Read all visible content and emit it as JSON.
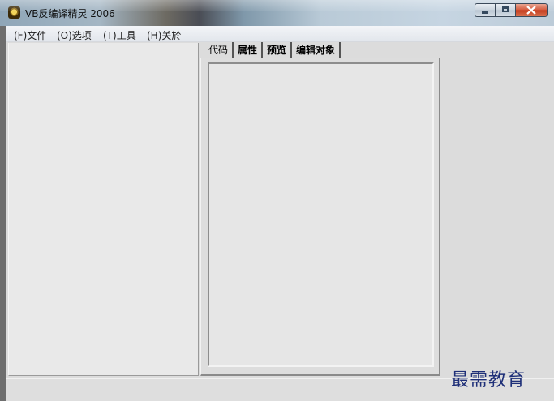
{
  "window": {
    "title": "VB反编译精灵 2006",
    "icon": "app-icon"
  },
  "menubar": {
    "items": [
      {
        "label": "(F)文件"
      },
      {
        "label": "(O)选项"
      },
      {
        "label": "(T)工具"
      },
      {
        "label": "(H)关於"
      }
    ]
  },
  "tabs": [
    {
      "label": "代码",
      "selected": true
    },
    {
      "label": "属性"
    },
    {
      "label": "预览"
    },
    {
      "label": "编辑对象"
    }
  ],
  "watermark": "最需教育",
  "colors": {
    "client_bg": "#e6e6e6",
    "panel_bg": "#dcdcdc",
    "close_button": "#c23b1d",
    "watermark": "#1e2f78"
  }
}
